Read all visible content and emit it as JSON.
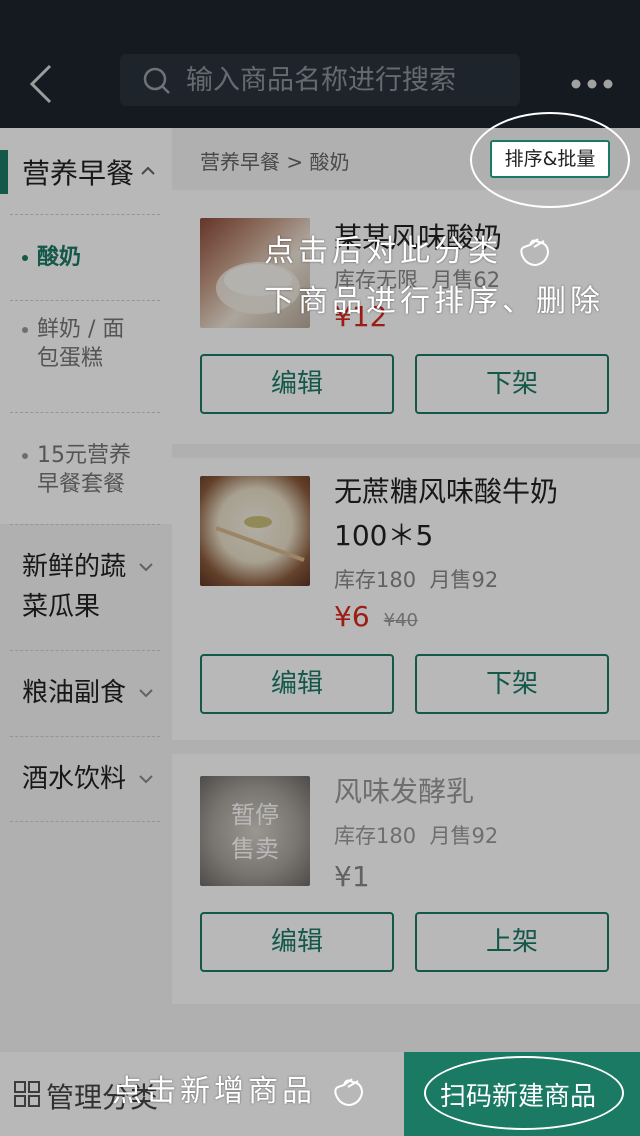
{
  "navbar": {
    "search_placeholder": "输入商品名称进行搜索"
  },
  "sidebar": {
    "active_category": "营养早餐",
    "subcategories": [
      {
        "label": "酸奶",
        "active": true
      },
      {
        "label": "鲜奶 / 面包蛋糕",
        "lines": [
          "鲜奶 / 面",
          "包蛋糕"
        ],
        "active": false
      },
      {
        "label": "15元营养早餐套餐",
        "lines": [
          "15元营养",
          "早餐套餐"
        ],
        "active": false
      }
    ],
    "categories": [
      {
        "lines": [
          "新鲜的蔬",
          "菜瓜果"
        ]
      },
      {
        "lines": [
          "粮油副食"
        ]
      },
      {
        "lines": [
          "酒水饮料"
        ]
      }
    ]
  },
  "main": {
    "breadcrumb": "营养早餐 > 酸奶",
    "sort_button": "排序&批量",
    "products": [
      {
        "name": "某某风味酸奶",
        "stock": "库存无限",
        "sales": "月售62",
        "price": "¥12",
        "orig_price": "",
        "edit": "编辑",
        "toggle": "下架"
      },
      {
        "name_lines": [
          "无蔗糖风味酸牛奶",
          "100＊5"
        ],
        "stock": "库存180",
        "sales": "月售92",
        "price": "¥6",
        "orig_price": "¥40",
        "edit": "编辑",
        "toggle": "下架"
      },
      {
        "name": "风味发酵乳",
        "paused_lines": [
          "暂停",
          "售卖"
        ],
        "stock": "库存180",
        "sales": "月售92",
        "price": "¥1",
        "edit": "编辑",
        "toggle": "上架"
      }
    ]
  },
  "bottombar": {
    "manage_label": "管理分类",
    "scan_label": "扫码新建商品"
  },
  "tips": {
    "sort_tip_lines": [
      "点击后对此分类",
      "下商品进行排序、删除"
    ],
    "add_tip": "点击新增商品"
  },
  "colors": {
    "accent": "#1b7a64",
    "price": "#d9281f",
    "navbar": "#1e252e"
  }
}
